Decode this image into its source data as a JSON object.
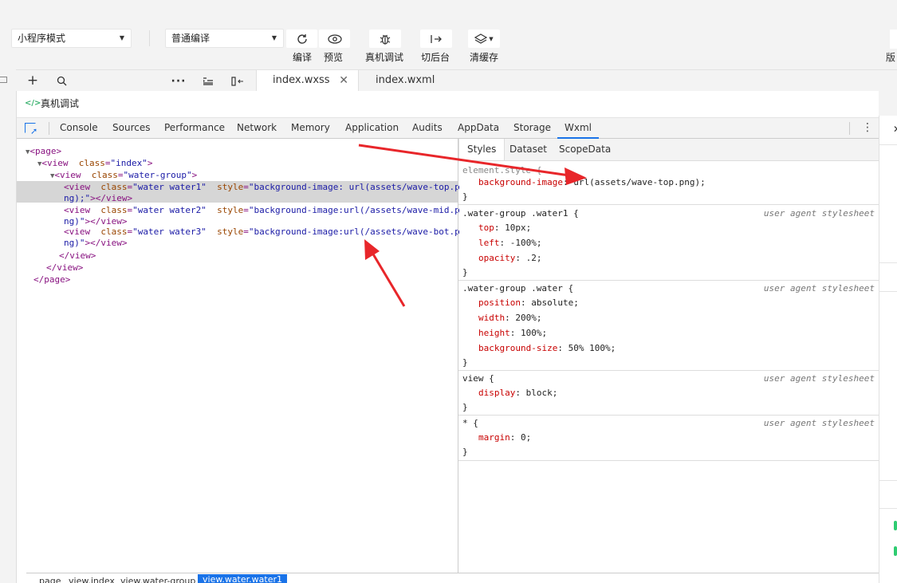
{
  "toolbar": {
    "mode_select": "小程序模式",
    "compile_select": "普通编译",
    "buttons": [
      {
        "label": "编译",
        "icon": "refresh-icon"
      },
      {
        "label": "预览",
        "icon": "eye-icon"
      },
      {
        "label": "真机调试",
        "icon": "bug-icon"
      },
      {
        "label": "切后台",
        "icon": "background-switch-icon"
      },
      {
        "label": "清缓存",
        "icon": "layers-icon"
      }
    ],
    "right_label": "版"
  },
  "editor": {
    "tabs": [
      {
        "label": "index.wxss",
        "active": true
      },
      {
        "label": "index.wxml",
        "active": false
      }
    ]
  },
  "panel": {
    "title": "真机调试",
    "devtools_tabs": [
      "Console",
      "Sources",
      "Performance",
      "Network",
      "Memory",
      "Application",
      "Audits",
      "AppData",
      "Storage",
      "Wxml"
    ],
    "active_tab": "Wxml"
  },
  "dom_tree": {
    "lines": [
      {
        "t1": "<page>",
        "t2": "",
        "t3": "",
        "t4": ""
      },
      {
        "t1": "<view ",
        "t2": "class",
        "t3": "\"index\"",
        "t4": ">"
      },
      {
        "t1": "<view ",
        "t2": "class",
        "t3": "\"water-group\"",
        "t4": ">"
      },
      {
        "t1": "<view ",
        "t2": "class",
        "t3": "\"water water1\"",
        "t4": ""
      },
      {
        "t1": "<view ",
        "t2": "class",
        "t3": "\"water water2\"",
        "t4": ""
      },
      {
        "t1": "<view ",
        "t2": "class",
        "t3": "\"water water3\"",
        "t4": ""
      },
      {
        "t1": "</view>",
        "t2": "",
        "t3": "",
        "t4": ""
      },
      {
        "t1": "</view>",
        "t2": "",
        "t3": "",
        "t4": ""
      },
      {
        "t1": "</page>",
        "t2": "",
        "t3": "",
        "t4": ""
      }
    ],
    "style_attr": "style",
    "style1": "\"background-image: url(assets/wave-top.p",
    "style1_wrap": "ng);\"",
    "style2": "\"background-image:url(/assets/wave-mid.p",
    "style2_wrap": "ng)\"",
    "style3": "\"background-image:url(/assets/wave-bot.p",
    "style3_wrap": "ng)\"",
    "close_view": "></view>",
    "close_view_wrap": "\"></view>"
  },
  "styles_panel": {
    "tabs": [
      "Styles",
      "Dataset",
      "ScopeData"
    ],
    "active": "Styles",
    "ua": "user agent stylesheet",
    "rules": [
      {
        "selector": "element.style {",
        "source": "",
        "props": [
          {
            "n": "background-image",
            "v": "url(assets/wave-top.png);"
          }
        ]
      },
      {
        "selector": ".water-group .water1 {",
        "source": "user agent stylesheet",
        "props": [
          {
            "n": "top",
            "v": "10px;"
          },
          {
            "n": "left",
            "v": "-100%;"
          },
          {
            "n": "opacity",
            "v": ".2;"
          }
        ]
      },
      {
        "selector": ".water-group .water {",
        "source": "user agent stylesheet",
        "props": [
          {
            "n": "position",
            "v": "absolute;"
          },
          {
            "n": "width",
            "v": "200%;"
          },
          {
            "n": "height",
            "v": "100%;"
          },
          {
            "n": "background-size",
            "v": "50% 100%;"
          }
        ]
      },
      {
        "selector": "view {",
        "source": "user agent stylesheet",
        "props": [
          {
            "n": "display",
            "v": "block;"
          }
        ]
      },
      {
        "selector": "* {",
        "source": "user agent stylesheet",
        "props": [
          {
            "n": "margin",
            "v": "0;"
          }
        ]
      }
    ]
  },
  "breadcrumbs": [
    "page",
    "view.index",
    "view.water-group",
    "view.water.water1"
  ],
  "colors": {
    "accent": "#1a73e8",
    "arrow": "#e8262a",
    "selected_row": "#d6d6d6"
  }
}
